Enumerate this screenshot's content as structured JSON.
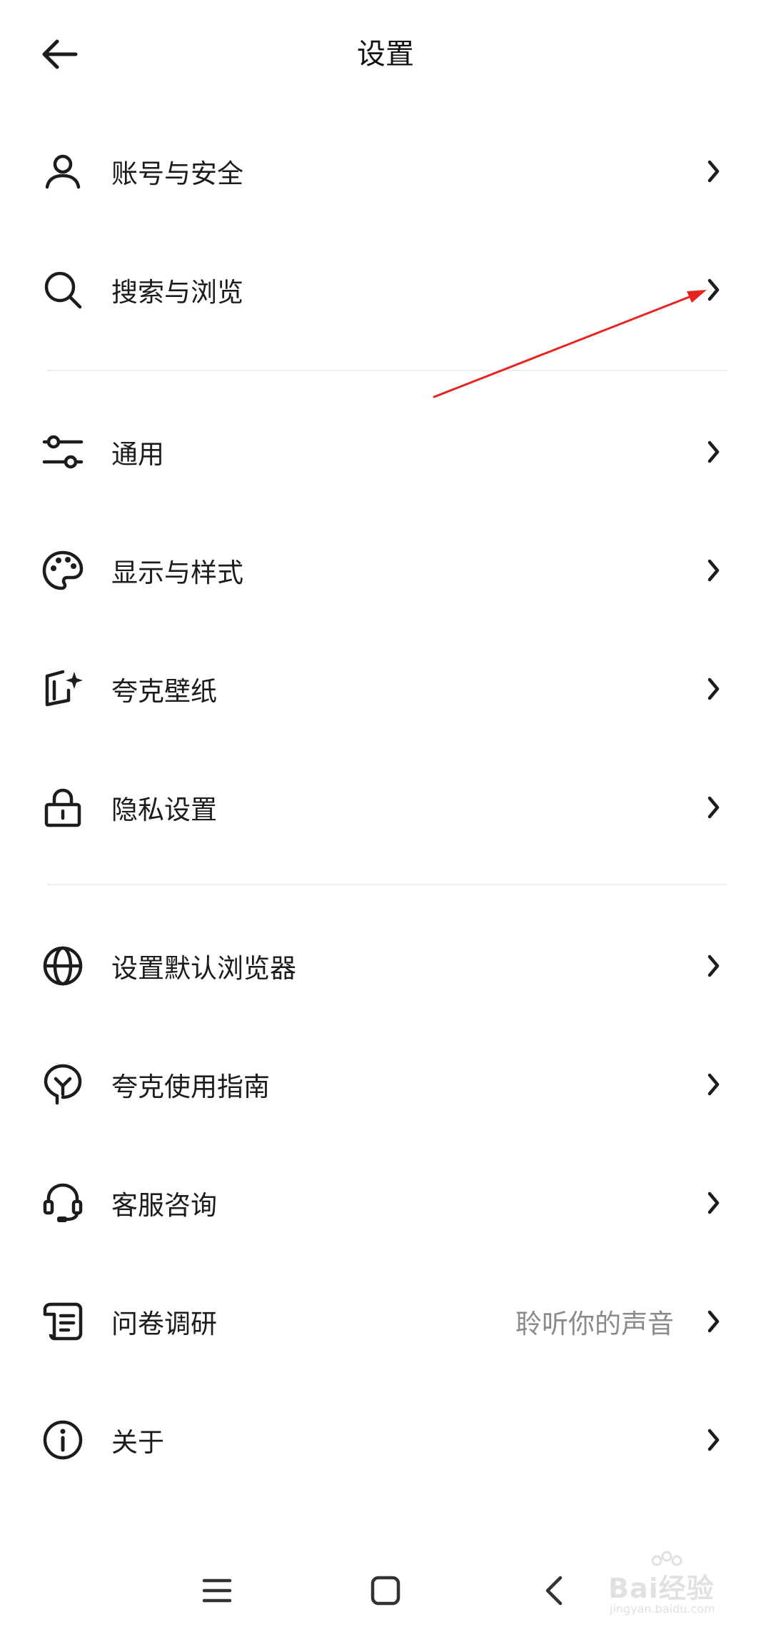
{
  "header": {
    "title": "设置",
    "back_icon": "arrow-left-icon"
  },
  "groups": [
    {
      "items": [
        {
          "label": "账号与安全",
          "icon": "user-icon",
          "value": ""
        },
        {
          "label": "搜索与浏览",
          "icon": "search-icon",
          "value": ""
        }
      ]
    },
    {
      "items": [
        {
          "label": "通用",
          "icon": "sliders-icon",
          "value": ""
        },
        {
          "label": "显示与样式",
          "icon": "palette-icon",
          "value": ""
        },
        {
          "label": "夸克壁纸",
          "icon": "wallpaper-icon",
          "value": ""
        },
        {
          "label": "隐私设置",
          "icon": "lock-icon",
          "value": ""
        }
      ]
    },
    {
      "items": [
        {
          "label": "设置默认浏览器",
          "icon": "globe-icon",
          "value": ""
        },
        {
          "label": "夸克使用指南",
          "icon": "lightbulb-icon",
          "value": ""
        },
        {
          "label": "客服咨询",
          "icon": "headset-icon",
          "value": ""
        },
        {
          "label": "问卷调研",
          "icon": "survey-icon",
          "value": "聆听你的声音"
        },
        {
          "label": "关于",
          "icon": "info-icon",
          "value": ""
        }
      ]
    }
  ],
  "navbar": {
    "menu_icon": "menu-icon",
    "home_icon": "home-square-icon",
    "back_icon": "chevron-left-icon"
  },
  "watermark": {
    "brand": "Bai经验",
    "url": "jingyan.baidu.com"
  },
  "colors": {
    "text": "#1c1c1c",
    "secondary": "#8a8a8a",
    "divider": "#ececec",
    "annotation_arrow": "#e8231d"
  }
}
